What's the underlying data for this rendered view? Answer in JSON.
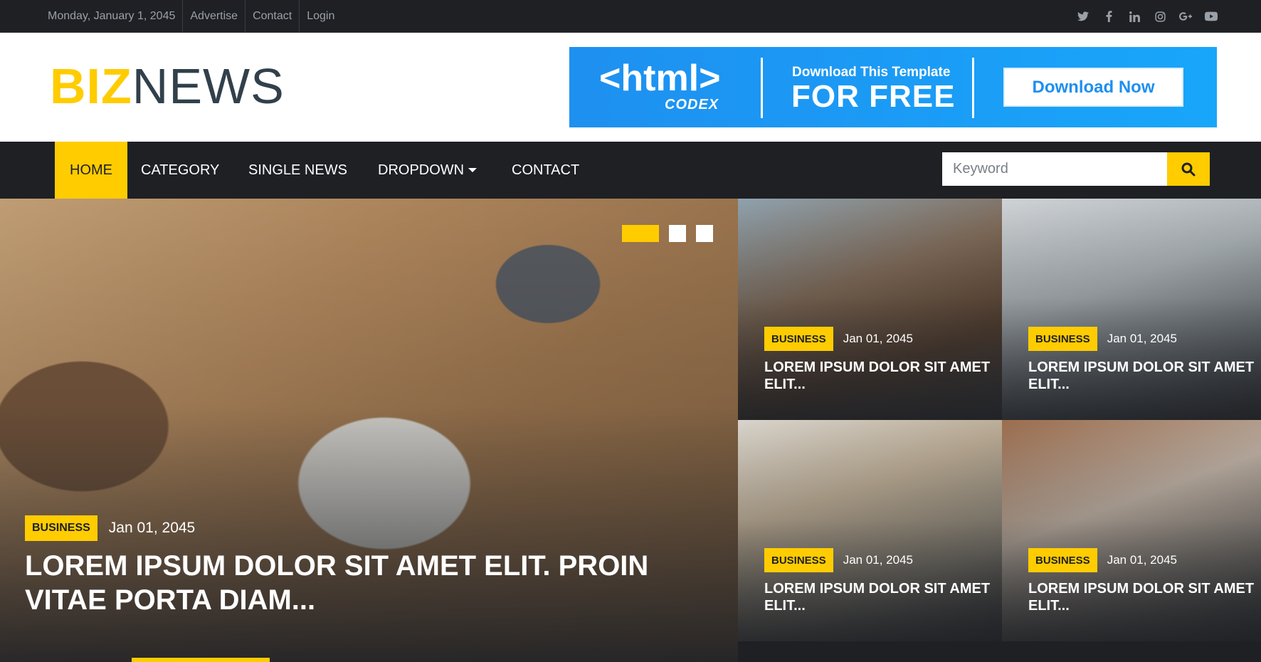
{
  "topbar": {
    "date": "Monday, January 1, 2045",
    "links": [
      "Advertise",
      "Contact",
      "Login"
    ],
    "social_icons": [
      "twitter-icon",
      "facebook-icon",
      "linkedin-icon",
      "instagram-icon",
      "google-plus-icon",
      "youtube-icon"
    ]
  },
  "logo": {
    "part1": "BIZ",
    "part2": "NEWS"
  },
  "ad": {
    "brand": "<html>",
    "brand_sub": "CODEX",
    "line1": "Download This Template",
    "line2": "FOR FREE",
    "button": "Download Now"
  },
  "nav": {
    "items": [
      "HOME",
      "CATEGORY",
      "SINGLE NEWS",
      "DROPDOWN",
      "CONTACT"
    ],
    "active": "HOME"
  },
  "search": {
    "placeholder": "Keyword"
  },
  "hero": {
    "category": "BUSINESS",
    "date": "Jan 01, 2045",
    "title": "LOREM IPSUM DOLOR SIT AMET ELIT. PROIN VITAE PORTA DIAM...",
    "slide_count": 3,
    "active_slide": 1
  },
  "grid": [
    {
      "category": "BUSINESS",
      "date": "Jan 01, 2045",
      "title": "LOREM IPSUM DOLOR SIT AMET ELIT..."
    },
    {
      "category": "BUSINESS",
      "date": "Jan 01, 2045",
      "title": "LOREM IPSUM DOLOR SIT AMET ELIT..."
    },
    {
      "category": "BUSINESS",
      "date": "Jan 01, 2045",
      "title": "LOREM IPSUM DOLOR SIT AMET ELIT..."
    },
    {
      "category": "BUSINESS",
      "date": "Jan 01, 2045",
      "title": "LOREM IPSUM DOLOR SIT AMET ELIT..."
    }
  ],
  "colors": {
    "accent": "#ffcc00",
    "dark": "#1e2024",
    "ad_blue": "#1e90f0"
  }
}
